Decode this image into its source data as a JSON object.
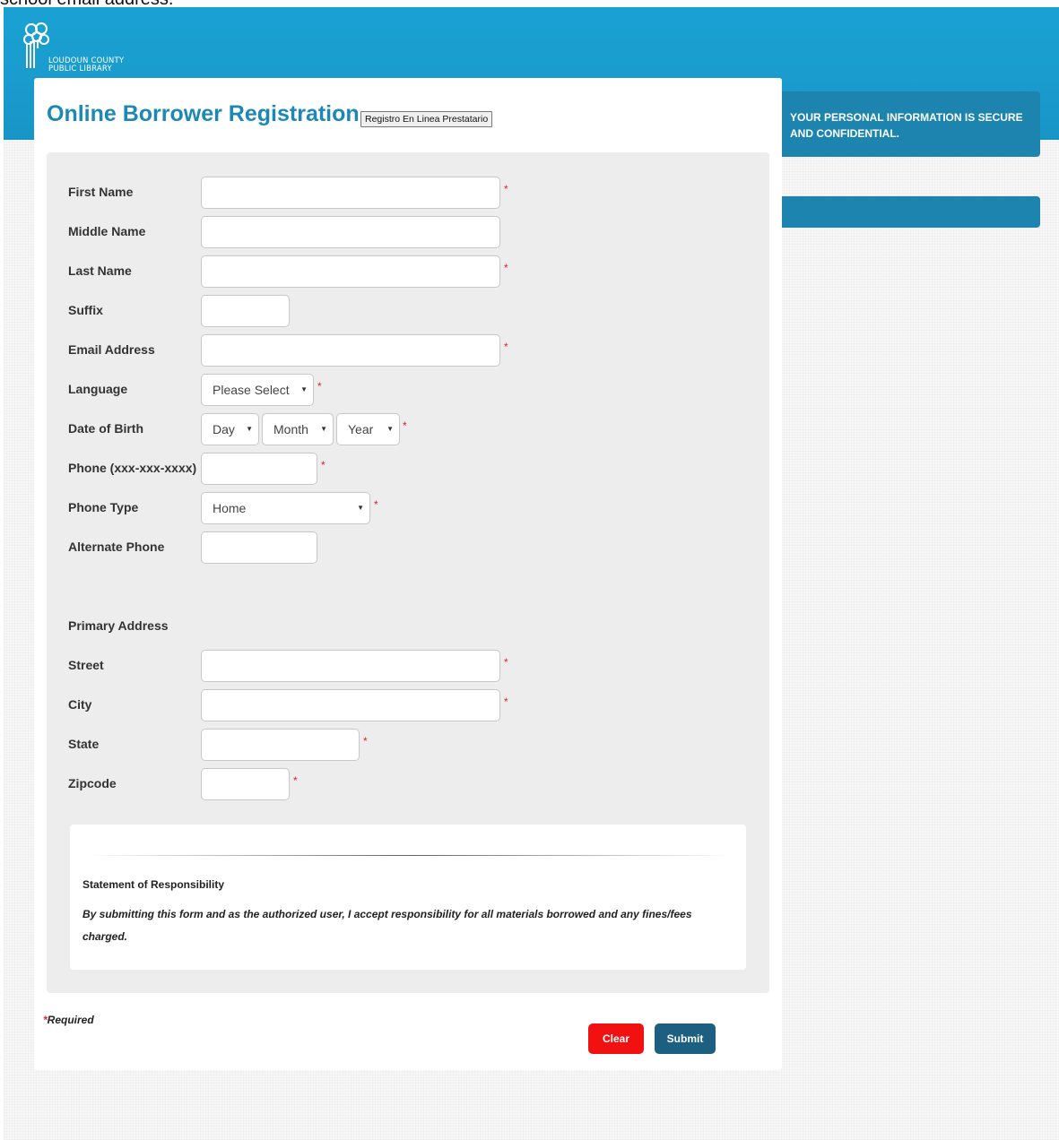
{
  "top_cut_text": "school email address.",
  "logo": {
    "line1": "LOUDOUN COUNTY",
    "line2": "PUBLIC LIBRARY"
  },
  "header": {
    "title": "Online Borrower Registration",
    "language_button": "Registro En Linea Prestatario"
  },
  "form": {
    "first_name": {
      "label": "First Name",
      "value": ""
    },
    "middle_name": {
      "label": "Middle Name",
      "value": ""
    },
    "last_name": {
      "label": "Last Name",
      "value": ""
    },
    "suffix": {
      "label": "Suffix",
      "value": ""
    },
    "email": {
      "label": "Email Address",
      "value": ""
    },
    "language": {
      "label": "Language",
      "selected": "Please Select"
    },
    "dob": {
      "label": "Date of Birth",
      "day": "Day",
      "month": "Month",
      "year": "Year"
    },
    "phone": {
      "label": "Phone (xxx-xxx-xxxx)",
      "value": ""
    },
    "phone_type": {
      "label": "Phone Type",
      "selected": "Home"
    },
    "alt_phone": {
      "label": "Alternate Phone",
      "value": ""
    },
    "primary_address": {
      "label": "Primary Address"
    },
    "street": {
      "label": "Street",
      "value": ""
    },
    "city": {
      "label": "City",
      "value": ""
    },
    "state": {
      "label": "State",
      "value": ""
    },
    "zipcode": {
      "label": "Zipcode",
      "value": ""
    },
    "required_marker": "*"
  },
  "statement": {
    "title": "Statement of Responsibility",
    "body": "By submitting this form and as the authorized user, I accept responsibility for all materials borrowed and any fines/fees charged."
  },
  "footer": {
    "required_star": "*",
    "required_text": "Required",
    "clear_label": "Clear",
    "submit_label": "Submit"
  },
  "sidebar": {
    "secure_text": "YOUR PERSONAL INFORMATION IS SECURE AND CONFIDENTIAL."
  },
  "colors": {
    "banner": "#1aa1d3",
    "title": "#1d88b6",
    "sidebar": "#1c84ae",
    "required": "#e02020",
    "clear_button": "#f21111",
    "submit_button": "#1c5f80"
  }
}
